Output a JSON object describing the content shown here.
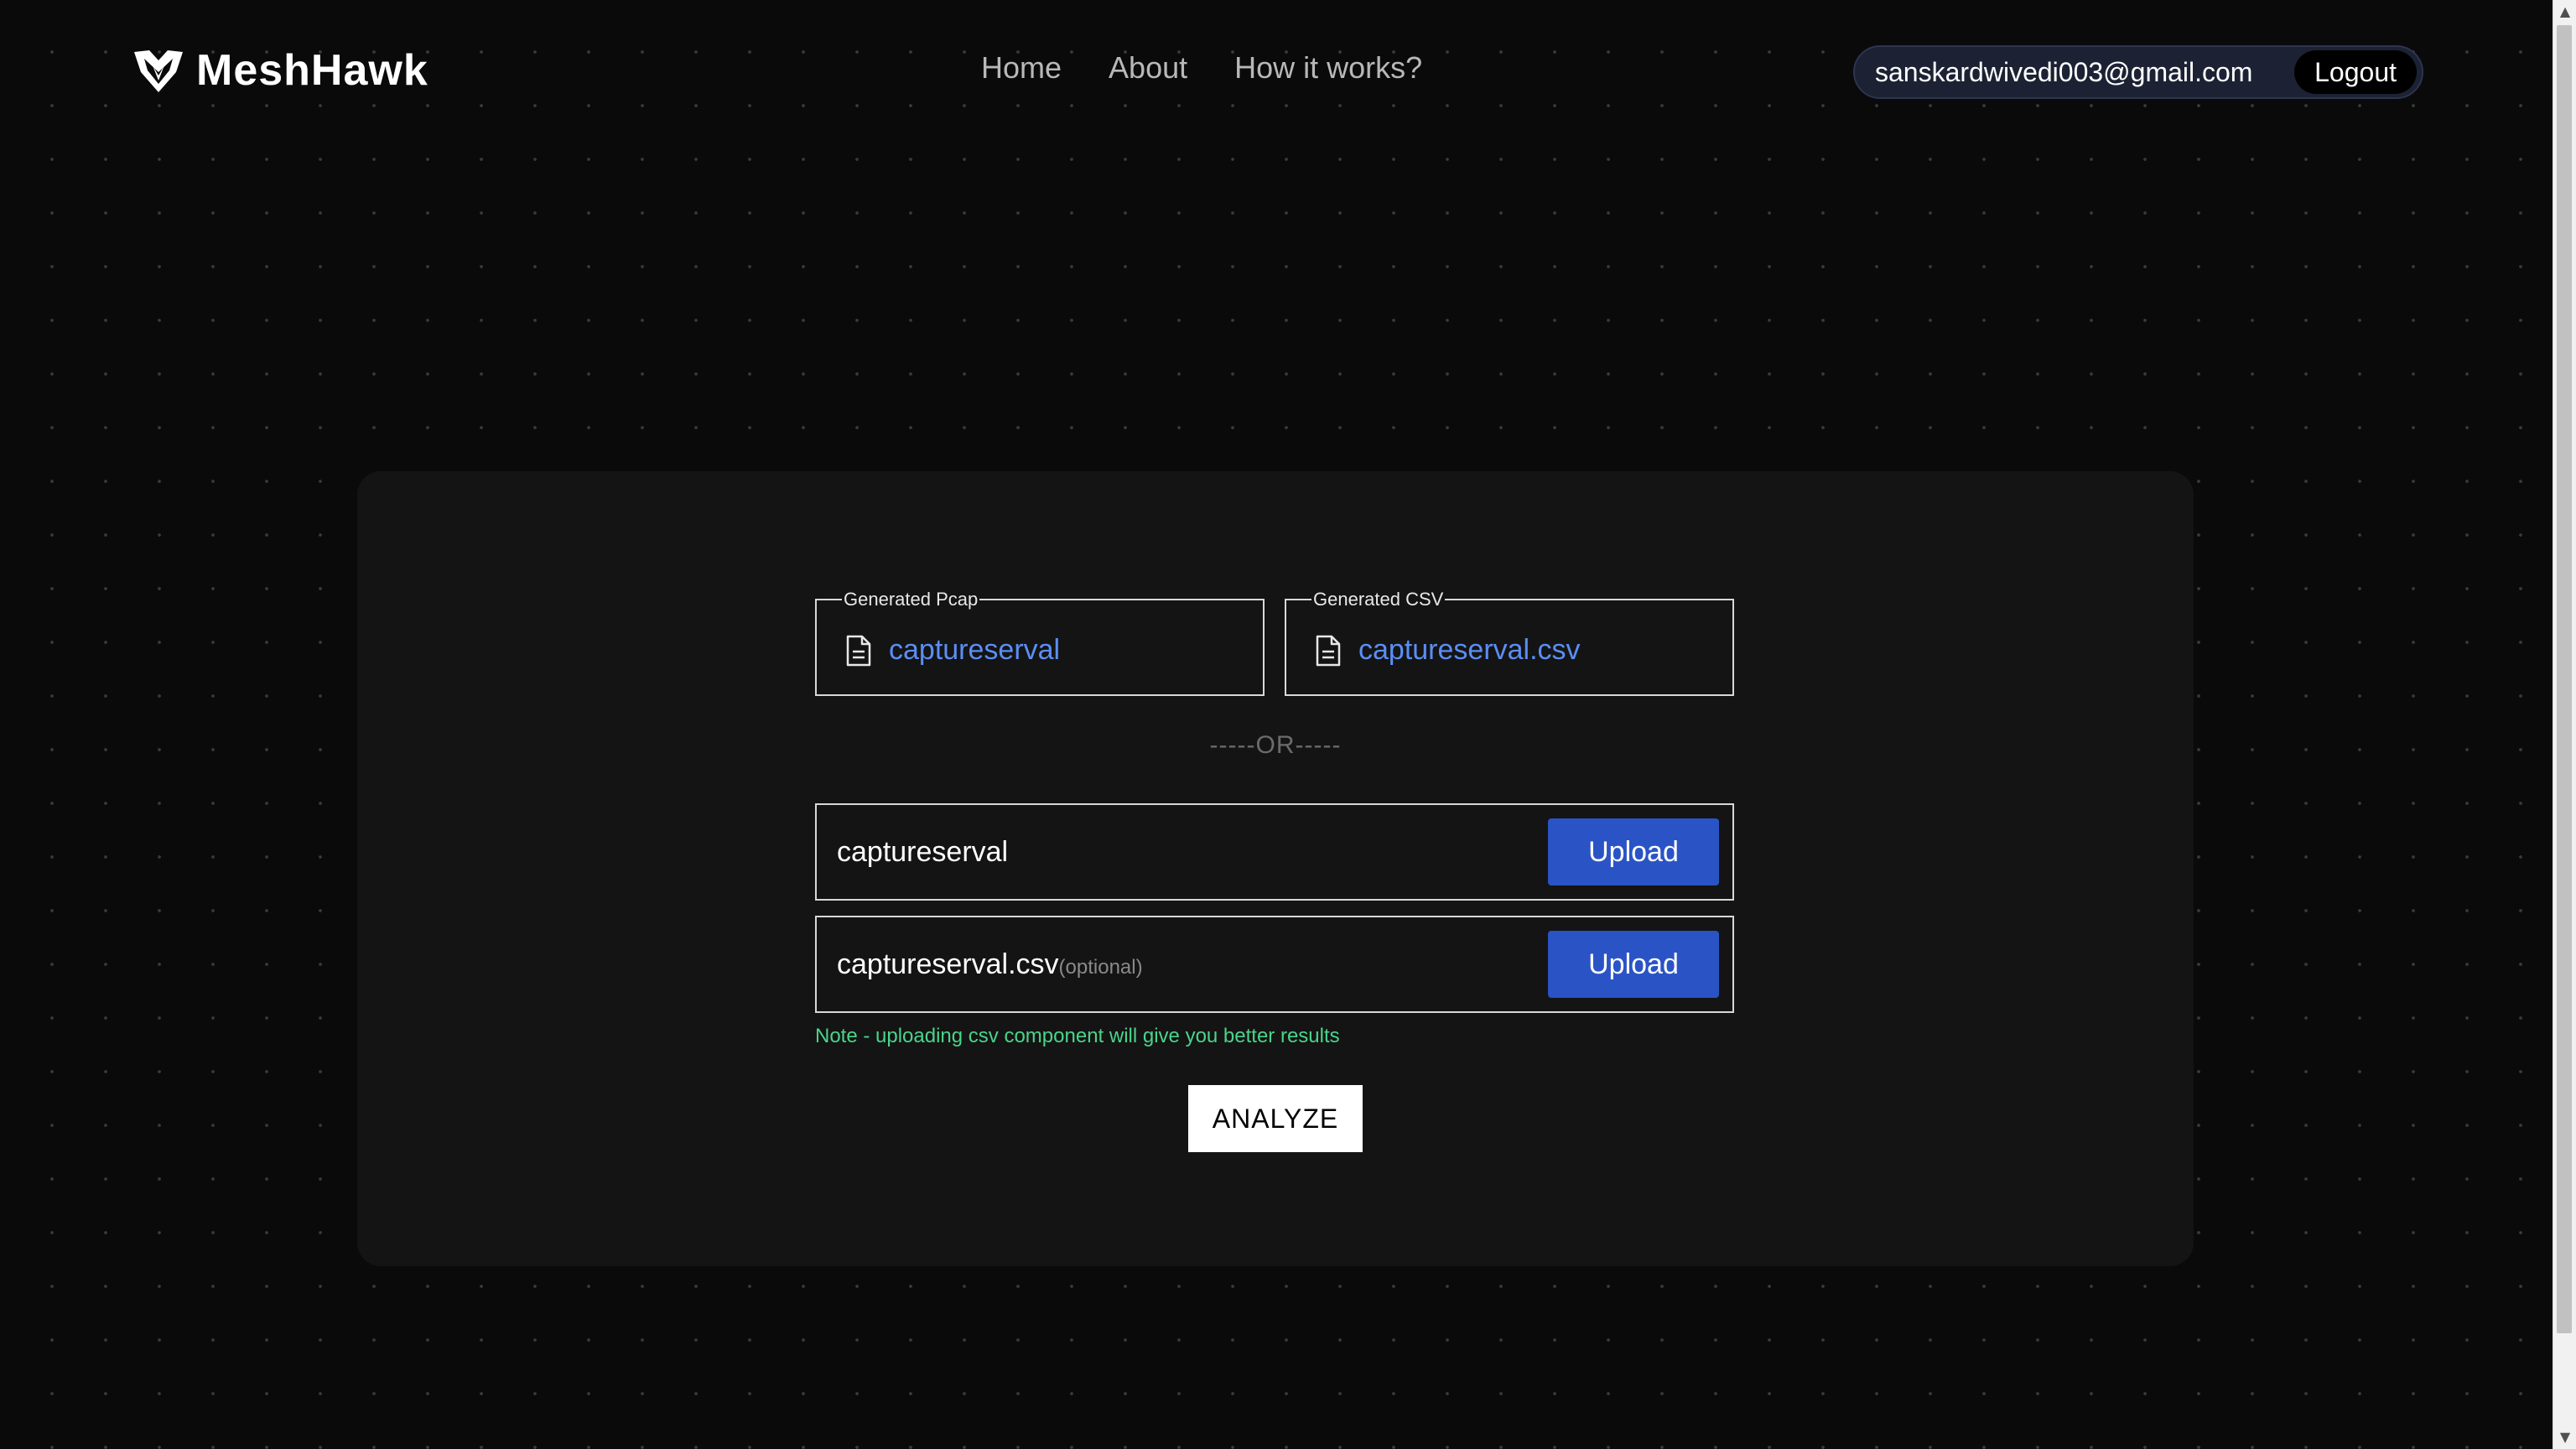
{
  "header": {
    "brand": "MeshHawk",
    "nav": {
      "home": "Home",
      "about": "About",
      "how": "How it works?"
    },
    "user": {
      "email": "sanskardwivedi003@gmail.com",
      "logout_label": "Logout"
    }
  },
  "generated": {
    "pcap": {
      "legend": "Generated Pcap",
      "file": "captureserval"
    },
    "csv": {
      "legend": "Generated CSV",
      "file": "captureserval.csv"
    }
  },
  "divider": "-----OR-----",
  "uploads": {
    "pcap": {
      "filename": "captureserval",
      "button": "Upload"
    },
    "csv": {
      "filename": "captureserval.csv",
      "optional": "(optional)",
      "button": "Upload"
    }
  },
  "note": "Note - uploading csv component will give you better results",
  "analyze_label": "ANALYZE",
  "colors": {
    "accent_blue": "#2a54c6",
    "link_blue": "#5b8ef5",
    "note_green": "#4ad48a",
    "background": "#0a0a0a",
    "card": "#141414"
  },
  "icons": {
    "logo": "hawk-shield-icon",
    "file": "document-icon"
  }
}
